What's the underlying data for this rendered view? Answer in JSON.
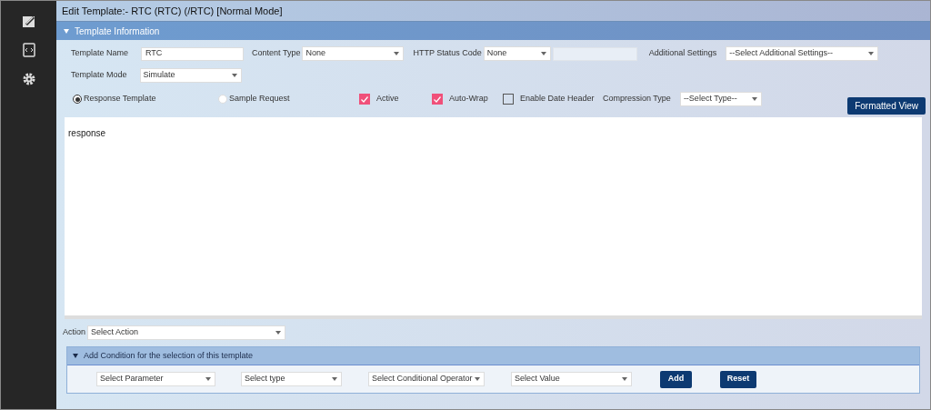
{
  "title": "Edit Template:- RTC (RTC) (/RTC) [Normal Mode]",
  "section": {
    "title": "Template Information",
    "expanded": true
  },
  "template_name": {
    "label": "Template Name",
    "value": "RTC"
  },
  "content_type": {
    "label": "Content Type",
    "value": "None"
  },
  "http_status": {
    "label": "HTTP Status Code",
    "value": "None"
  },
  "additional_settings": {
    "label": "Additional Settings",
    "value": "--Select Additional Settings--"
  },
  "template_mode": {
    "label": "Template Mode",
    "value": "Simulate"
  },
  "radios": [
    {
      "label": "Response Template",
      "selected": true
    },
    {
      "label": "Sample Request",
      "selected": false
    }
  ],
  "checkboxes": [
    {
      "label": "Active",
      "checked": true
    },
    {
      "label": "Auto-Wrap",
      "checked": true
    },
    {
      "label": "Enable Date Header",
      "checked": false
    }
  ],
  "compression": {
    "label": "Compression Type",
    "value": "--Select Type--"
  },
  "formatted_view_button": "Formatted View",
  "editor_text": "response",
  "action": {
    "label": "Action",
    "value": "Select Action"
  },
  "condition": {
    "title": "Add Condition for the selection of this template",
    "expanded": true,
    "selects": [
      "Select Parameter",
      "Select type",
      "Select Conditional Operator",
      "Select Value"
    ],
    "buttons": [
      "Add",
      "Reset"
    ]
  }
}
